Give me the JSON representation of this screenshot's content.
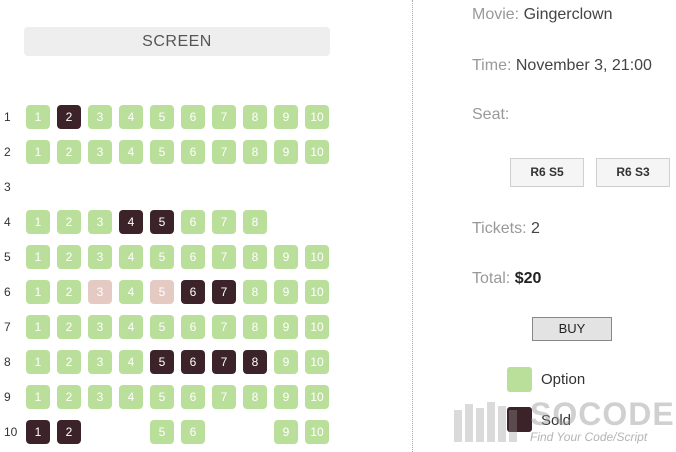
{
  "screen_label": "SCREEN",
  "seat_map": {
    "rows": [
      {
        "label": "1",
        "seats": [
          {
            "n": "1",
            "s": "option"
          },
          {
            "n": "2",
            "s": "sold"
          },
          {
            "n": "3",
            "s": "option"
          },
          {
            "n": "4",
            "s": "option"
          },
          {
            "n": "5",
            "s": "option"
          },
          {
            "n": "6",
            "s": "option"
          },
          {
            "n": "7",
            "s": "option"
          },
          {
            "n": "8",
            "s": "option"
          },
          {
            "n": "9",
            "s": "option"
          },
          {
            "n": "10",
            "s": "option"
          }
        ]
      },
      {
        "label": "2",
        "seats": [
          {
            "n": "1",
            "s": "option"
          },
          {
            "n": "2",
            "s": "option"
          },
          {
            "n": "3",
            "s": "option"
          },
          {
            "n": "4",
            "s": "option"
          },
          {
            "n": "5",
            "s": "option"
          },
          {
            "n": "6",
            "s": "option"
          },
          {
            "n": "7",
            "s": "option"
          },
          {
            "n": "8",
            "s": "option"
          },
          {
            "n": "9",
            "s": "option"
          },
          {
            "n": "10",
            "s": "option"
          }
        ]
      },
      {
        "label": "3",
        "seats": []
      },
      {
        "label": "4",
        "seats": [
          {
            "n": "1",
            "s": "option"
          },
          {
            "n": "2",
            "s": "option"
          },
          {
            "n": "3",
            "s": "option"
          },
          {
            "n": "4",
            "s": "sold"
          },
          {
            "n": "5",
            "s": "sold"
          },
          {
            "n": "6",
            "s": "option"
          },
          {
            "n": "7",
            "s": "option"
          },
          {
            "n": "8",
            "s": "option"
          },
          null,
          null
        ]
      },
      {
        "label": "5",
        "seats": [
          {
            "n": "1",
            "s": "option"
          },
          {
            "n": "2",
            "s": "option"
          },
          {
            "n": "3",
            "s": "option"
          },
          {
            "n": "4",
            "s": "option"
          },
          {
            "n": "5",
            "s": "option"
          },
          {
            "n": "6",
            "s": "option"
          },
          {
            "n": "7",
            "s": "option"
          },
          {
            "n": "8",
            "s": "option"
          },
          {
            "n": "9",
            "s": "option"
          },
          {
            "n": "10",
            "s": "option"
          }
        ]
      },
      {
        "label": "6",
        "seats": [
          {
            "n": "1",
            "s": "option"
          },
          {
            "n": "2",
            "s": "option"
          },
          {
            "n": "3",
            "s": "selected"
          },
          {
            "n": "4",
            "s": "option"
          },
          {
            "n": "5",
            "s": "selected"
          },
          {
            "n": "6",
            "s": "sold"
          },
          {
            "n": "7",
            "s": "sold"
          },
          {
            "n": "8",
            "s": "option"
          },
          {
            "n": "9",
            "s": "option"
          },
          {
            "n": "10",
            "s": "option"
          }
        ]
      },
      {
        "label": "7",
        "seats": [
          {
            "n": "1",
            "s": "option"
          },
          {
            "n": "2",
            "s": "option"
          },
          {
            "n": "3",
            "s": "option"
          },
          {
            "n": "4",
            "s": "option"
          },
          {
            "n": "5",
            "s": "option"
          },
          {
            "n": "6",
            "s": "option"
          },
          {
            "n": "7",
            "s": "option"
          },
          {
            "n": "8",
            "s": "option"
          },
          {
            "n": "9",
            "s": "option"
          },
          {
            "n": "10",
            "s": "option"
          }
        ]
      },
      {
        "label": "8",
        "seats": [
          {
            "n": "1",
            "s": "option"
          },
          {
            "n": "2",
            "s": "option"
          },
          {
            "n": "3",
            "s": "option"
          },
          {
            "n": "4",
            "s": "option"
          },
          {
            "n": "5",
            "s": "sold"
          },
          {
            "n": "6",
            "s": "sold"
          },
          {
            "n": "7",
            "s": "sold"
          },
          {
            "n": "8",
            "s": "sold"
          },
          {
            "n": "9",
            "s": "option"
          },
          {
            "n": "10",
            "s": "option"
          }
        ]
      },
      {
        "label": "9",
        "seats": [
          {
            "n": "1",
            "s": "option"
          },
          {
            "n": "2",
            "s": "option"
          },
          {
            "n": "3",
            "s": "option"
          },
          {
            "n": "4",
            "s": "option"
          },
          {
            "n": "5",
            "s": "option"
          },
          {
            "n": "6",
            "s": "option"
          },
          {
            "n": "7",
            "s": "option"
          },
          {
            "n": "8",
            "s": "option"
          },
          {
            "n": "9",
            "s": "option"
          },
          {
            "n": "10",
            "s": "option"
          }
        ]
      },
      {
        "label": "10",
        "seats": [
          {
            "n": "1",
            "s": "sold"
          },
          {
            "n": "2",
            "s": "sold"
          },
          null,
          null,
          {
            "n": "5",
            "s": "option"
          },
          {
            "n": "6",
            "s": "option"
          },
          null,
          null,
          {
            "n": "9",
            "s": "option"
          },
          {
            "n": "10",
            "s": "option"
          }
        ]
      }
    ]
  },
  "info": {
    "movie_label": "Movie: ",
    "movie_value": "Gingerclown",
    "time_label": "Time: ",
    "time_value": "November 3, 21:00",
    "seat_label": "Seat:",
    "selected_seats": [
      "R6 S5",
      "R6 S3"
    ],
    "tickets_label": "Tickets: ",
    "tickets_value": "2",
    "total_label": "Total: ",
    "total_value": "$20"
  },
  "buy_label": "BUY",
  "legend": {
    "option_label": "Option",
    "sold_label": "Sold"
  },
  "colors": {
    "option": "#b9df9b",
    "sold": "#3c2329",
    "selected": "#e5cac3"
  },
  "watermark": {
    "brand": "SOCODE",
    "tagline": "Find Your Code/Script"
  }
}
